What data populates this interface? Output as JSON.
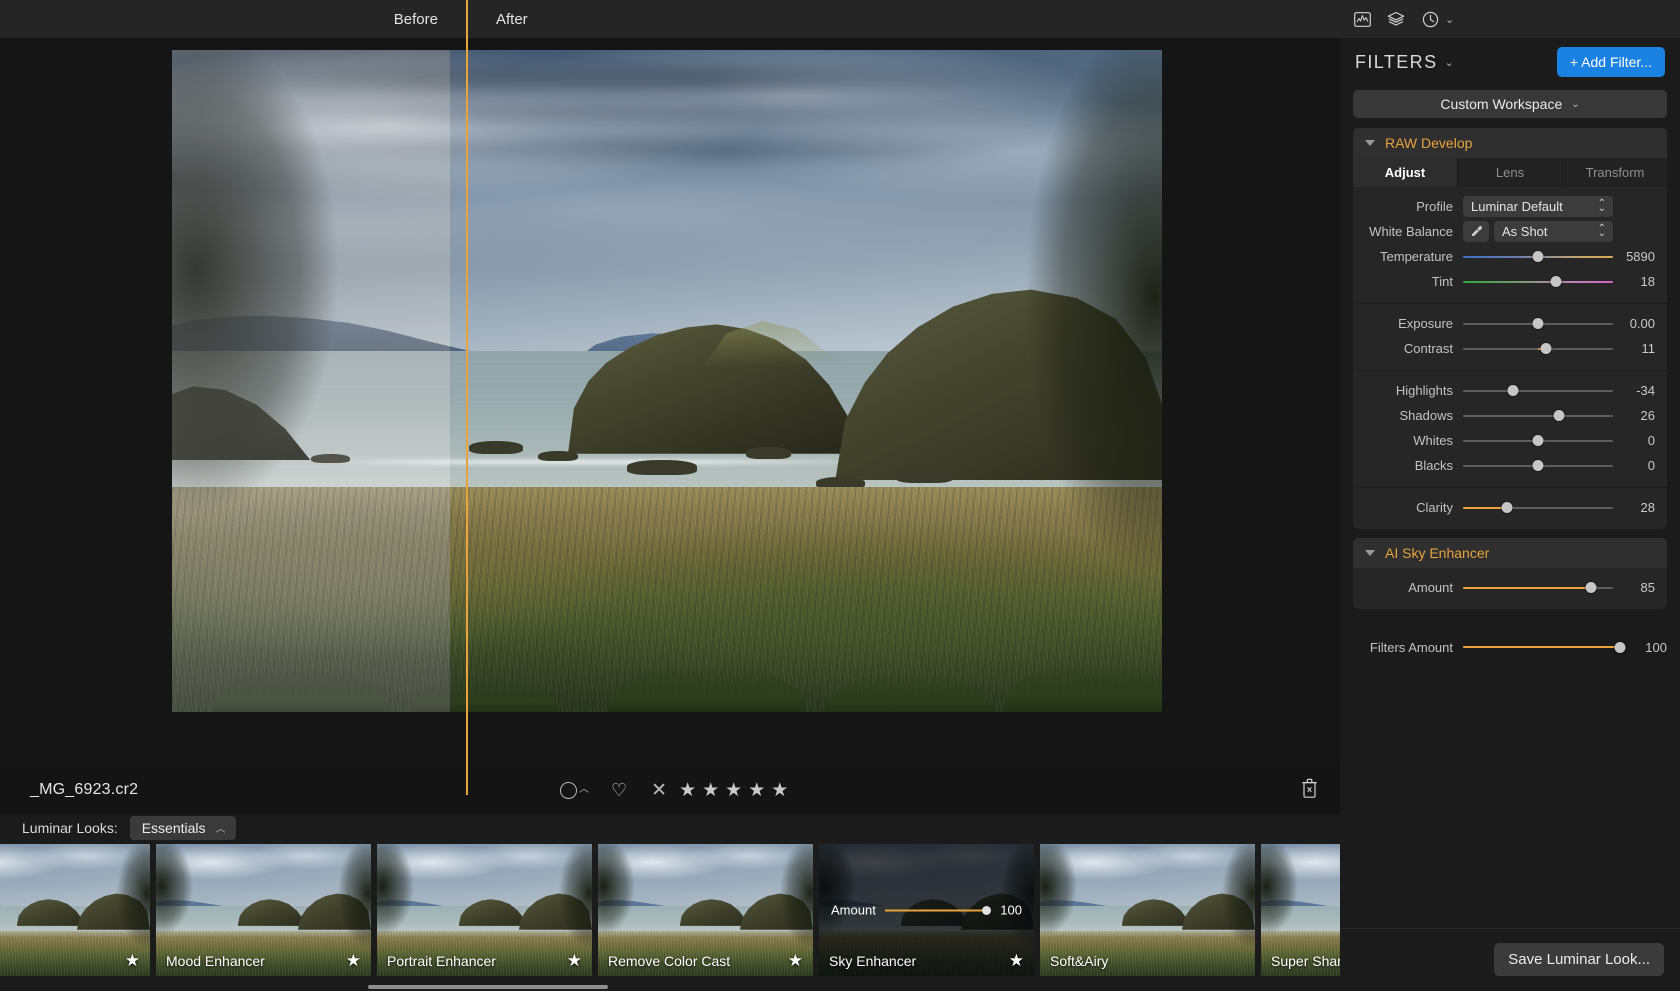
{
  "topbar": {
    "before_label": "Before",
    "after_label": "After",
    "icons": [
      "histogram-icon",
      "layers-icon",
      "history-clock-icon"
    ]
  },
  "info": {
    "filename": "_MG_6923.cr2",
    "rating_stars": 5,
    "reject_label": "×",
    "trash_label": "delete"
  },
  "looks": {
    "label": "Luminar Looks:",
    "category": "Essentials",
    "items": [
      {
        "name": "",
        "selected": false,
        "starred": true
      },
      {
        "name": "Mood Enhancer",
        "selected": false,
        "starred": true
      },
      {
        "name": "Portrait Enhancer",
        "selected": false,
        "starred": true
      },
      {
        "name": "Remove Color Cast",
        "selected": false,
        "starred": true
      },
      {
        "name": "Sky Enhancer",
        "selected": true,
        "starred": true,
        "amount_label": "Amount",
        "amount_value": "100"
      },
      {
        "name": "Soft&Airy",
        "selected": false,
        "starred": false
      },
      {
        "name": "Super Sharp",
        "selected": false,
        "starred": false
      }
    ]
  },
  "panel": {
    "title": "FILTERS",
    "add_filter_label": "+ Add Filter...",
    "workspace_label": "Custom Workspace",
    "save_look_label": "Save Luminar Look...",
    "accent_color": "#e8a33d",
    "add_button_color": "#1a82e2",
    "groups": [
      {
        "title": "RAW Develop",
        "tabs": [
          {
            "label": "Adjust",
            "active": true
          },
          {
            "label": "Lens",
            "active": false
          },
          {
            "label": "Transform",
            "active": false
          }
        ],
        "controls": [
          {
            "type": "select",
            "label": "Profile",
            "value": "Luminar Default"
          },
          {
            "type": "select-eyedropper",
            "label": "White Balance",
            "value": "As Shot"
          },
          {
            "type": "slider",
            "label": "Temperature",
            "value": "5890",
            "pct": 50,
            "track": "temp"
          },
          {
            "type": "slider",
            "label": "Tint",
            "value": "18",
            "pct": 62,
            "track": "tint"
          },
          {
            "type": "slider",
            "label": "Exposure",
            "value": "0.00",
            "pct": 50,
            "track": "plain"
          },
          {
            "type": "slider",
            "label": "Contrast",
            "value": "11",
            "pct": 55,
            "track": "plain",
            "fill_from": 50
          },
          {
            "type": "slider",
            "label": "Highlights",
            "value": "-34",
            "pct": 33,
            "track": "plain"
          },
          {
            "type": "slider",
            "label": "Shadows",
            "value": "26",
            "pct": 64,
            "track": "plain"
          },
          {
            "type": "slider",
            "label": "Whites",
            "value": "0",
            "pct": 50,
            "track": "plain"
          },
          {
            "type": "slider",
            "label": "Blacks",
            "value": "0",
            "pct": 50,
            "track": "plain"
          },
          {
            "type": "slider",
            "label": "Clarity",
            "value": "28",
            "pct": 29,
            "track": "plain",
            "fill_from": 0
          }
        ]
      },
      {
        "title": "AI Sky Enhancer",
        "controls": [
          {
            "type": "slider",
            "label": "Amount",
            "value": "85",
            "pct": 85,
            "track": "plain",
            "fill_from": 0
          }
        ]
      }
    ],
    "filters_amount": {
      "label": "Filters Amount",
      "value": "100",
      "pct": 97
    }
  }
}
